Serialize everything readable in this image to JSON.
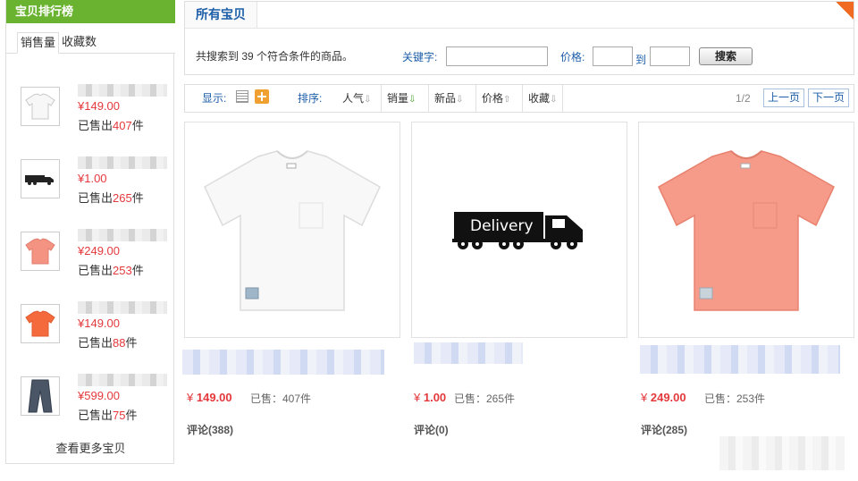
{
  "sidebar": {
    "title": "宝贝排行榜",
    "tabs": [
      {
        "label": "销售量",
        "active": true
      },
      {
        "label": "收藏数",
        "active": false
      }
    ],
    "items": [
      {
        "price": "¥149.00",
        "sold_prefix": "已售出",
        "sold_count": "407",
        "sold_suffix": "件",
        "thumb": "white-tshirt"
      },
      {
        "price": "¥1.00",
        "sold_prefix": "已售出",
        "sold_count": "265",
        "sold_suffix": "件",
        "thumb": "delivery-truck"
      },
      {
        "price": "¥249.00",
        "sold_prefix": "已售出",
        "sold_count": "253",
        "sold_suffix": "件",
        "thumb": "pink-tshirt"
      },
      {
        "price": "¥149.00",
        "sold_prefix": "已售出",
        "sold_count": "88",
        "sold_suffix": "件",
        "thumb": "orange-tshirt"
      },
      {
        "price": "¥599.00",
        "sold_prefix": "已售出",
        "sold_count": "75",
        "sold_suffix": "件",
        "thumb": "jeans"
      }
    ],
    "more_link": "查看更多宝贝"
  },
  "search": {
    "title": "所有宝贝",
    "result_text": "共搜索到 39 个符合条件的商品。",
    "keyword_label": "关键字:",
    "keyword_value": "",
    "price_label": "价格:",
    "price_from": "",
    "to_label": "到",
    "price_to": "",
    "button_label": "搜索"
  },
  "sort_bar": {
    "display_label": "显示:",
    "sort_label": "排序:",
    "sorts": [
      {
        "label": "人气",
        "arrow": "⇩",
        "active": false
      },
      {
        "label": "销量",
        "arrow": "⇩",
        "active": true
      },
      {
        "label": "新品",
        "arrow": "⇩",
        "active": false
      },
      {
        "label": "价格",
        "arrow": "⇧",
        "active": false
      },
      {
        "label": "收藏",
        "arrow": "⇩",
        "active": false
      }
    ],
    "page_info": "1/2",
    "prev_label": "上一页",
    "next_label": "下一页"
  },
  "products": [
    {
      "price_symbol": "¥",
      "price": "149.00",
      "sold": "已售：407件",
      "comments": "评论(388)",
      "image": "white-tshirt"
    },
    {
      "price_symbol": "¥",
      "price": "1.00",
      "sold": "已售：265件",
      "comments": "评论(0)",
      "image": "delivery-truck",
      "image_text": "Delivery"
    },
    {
      "price_symbol": "¥",
      "price": "249.00",
      "sold": "已售：253件",
      "comments": "评论(285)",
      "image": "pink-tshirt"
    }
  ],
  "colors": {
    "accent_green": "#6ab330",
    "link_blue": "#1d5ea8",
    "price_red": "#e4393c",
    "badge_orange": "#f06a21"
  }
}
